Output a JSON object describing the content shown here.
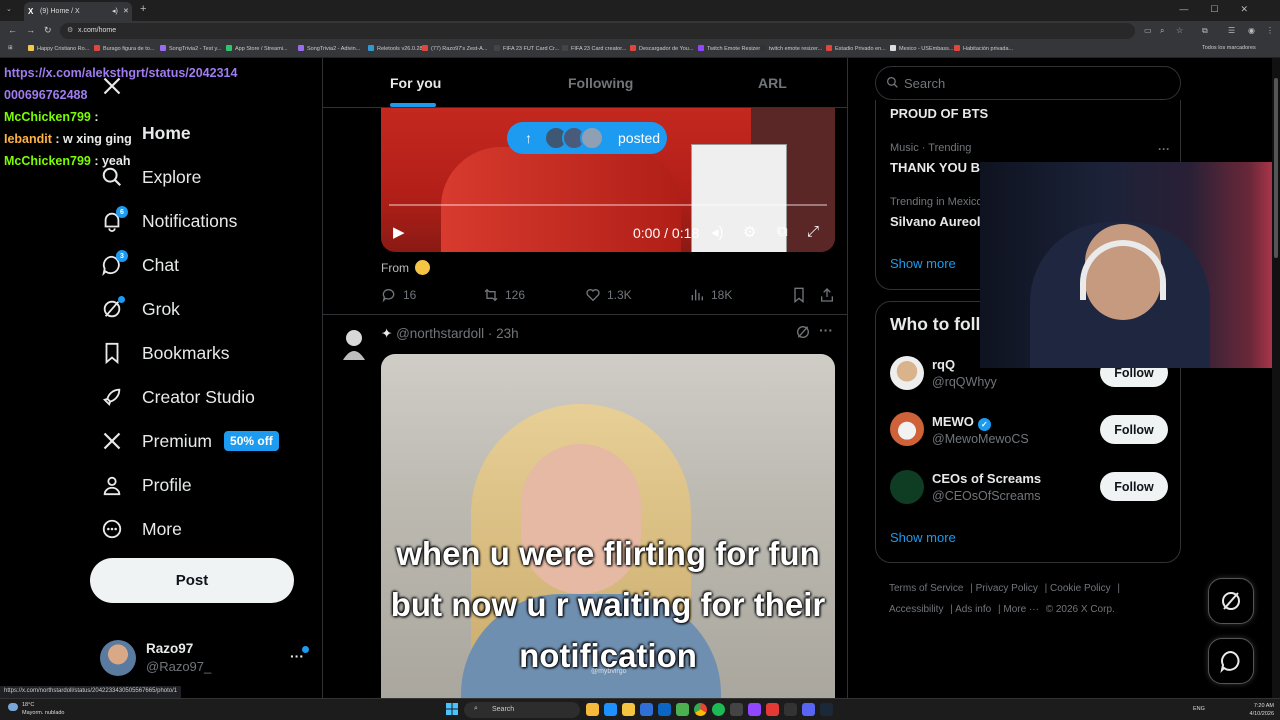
{
  "browser": {
    "tab_title": "(9) Home / X",
    "url": "x.com/home",
    "bookmarks": [
      {
        "label": "Happy Cristiano Ro...",
        "color": "#f2c94c"
      },
      {
        "label": "Burago figura de to...",
        "color": "#e0463b"
      },
      {
        "label": "SongTrivia2 - Test y...",
        "color": "#9b6cf0"
      },
      {
        "label": "App Store / Streami...",
        "color": "#2ec66b"
      },
      {
        "label": "SongTrivia2 - Adivin...",
        "color": "#9b6cf0"
      },
      {
        "label": "Reletools v26.0.28",
        "color": "#39c"
      },
      {
        "label": "(77) Razo97's Zest-A...",
        "color": "#e0463b"
      },
      {
        "label": "FIFA 23 FUT Card Cr...",
        "color": "#444"
      },
      {
        "label": "FIFA 23 Card creator...",
        "color": "#444"
      },
      {
        "label": "Descargador de You...",
        "color": "#e0463b"
      },
      {
        "label": "Twitch Emote Resizer",
        "color": "#9146ff"
      },
      {
        "label": "twitch emote resizer...",
        "color": "#333"
      },
      {
        "label": "Estadio Privado en...",
        "color": "#e0463b"
      },
      {
        "label": "Mexico - USEmbass...",
        "color": "#ddd"
      },
      {
        "label": "Habitación privada...",
        "color": "#e0463b"
      }
    ],
    "all_bookmarks": "Todos los marcadores",
    "status_url": "https://x.com/northstardoll/status/2042233430505567665/photo/1"
  },
  "chat": [
    {
      "user": "",
      "text": "https://x.com/aleksthgrt/status/2042314000696762488",
      "user_color": "#a07cf0",
      "is_url": true
    },
    {
      "user": "McChicken799",
      "text": " : ",
      "user_color": "#7cfc00"
    },
    {
      "user": "Iebandit",
      "text": " : w xing ging",
      "user_color": "#ffb347"
    },
    {
      "user": "McChicken799",
      "text": " : yeah",
      "user_color": "#7cfc00"
    }
  ],
  "nav": {
    "home": "Home",
    "explore": "Explore",
    "notifications": "Notifications",
    "notifications_badge": "6",
    "chat": "Chat",
    "chat_badge": "3",
    "grok": "Grok",
    "bookmarks": "Bookmarks",
    "creator_studio": "Creator Studio",
    "premium": "Premium",
    "premium_promo": "50% off",
    "profile": "Profile",
    "more": "More",
    "post_button": "Post"
  },
  "account": {
    "name": "Razo97",
    "handle": "@Razo97_"
  },
  "timeline": {
    "tabs": [
      "For you",
      "Following",
      "ARL"
    ],
    "posted_pill": "posted",
    "post1": {
      "video_time": "0:00 / 0:18",
      "caption": "From",
      "replies": "16",
      "reposts": "126",
      "likes": "1.3K",
      "views": "18K"
    },
    "post2": {
      "handle": "@northstardoll",
      "time": "23h",
      "meme_text": "when u were flirting for fun but now u r waiting for their notification",
      "watermark": "@mybvirgo"
    }
  },
  "sidebar_right": {
    "search_placeholder": "Search",
    "trends": [
      {
        "meta": "",
        "name": "PROUD OF BTS"
      },
      {
        "meta": "Music · Trending",
        "name": "THANK YOU BTS"
      },
      {
        "meta": "Trending in Mexico",
        "name": "Silvano Aureoles"
      }
    ],
    "show_more": "Show more",
    "who_to_follow_title": "Who to follow",
    "who_to_follow": [
      {
        "name": "rqQ",
        "handle": "@rqQWhyy",
        "verified": false,
        "button": "Follow"
      },
      {
        "name": "MEWO",
        "handle": "@MewoMewoCS",
        "verified": true,
        "button": "Follow"
      },
      {
        "name": "CEOs of Screams",
        "handle": "@CEOsOfScreams",
        "verified": false,
        "button": "Follow"
      }
    ],
    "footer_links": [
      "Terms of Service",
      "Privacy Policy",
      "Cookie Policy",
      "Accessibility",
      "Ads info",
      "More ···",
      "© 2026 X Corp."
    ]
  },
  "taskbar": {
    "weather_temp": "18°C",
    "weather_desc": "Mayorm. nublado",
    "search": "Search",
    "lang": "ENG",
    "time": "7:20 AM",
    "date": "4/10/2026"
  }
}
